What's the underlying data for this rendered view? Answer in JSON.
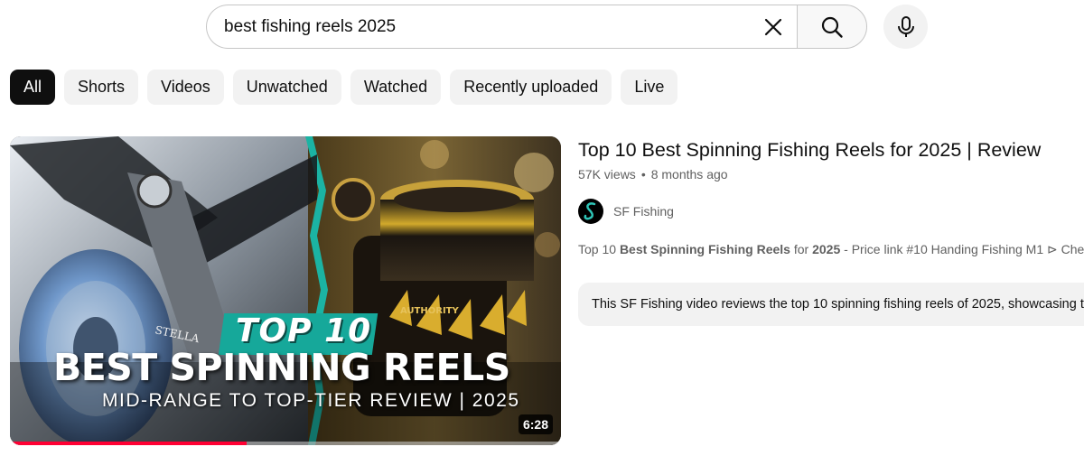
{
  "search": {
    "query": "best fishing reels 2025",
    "clear_icon": "close-icon",
    "search_icon": "search-icon",
    "mic_icon": "microphone-icon"
  },
  "chips": [
    "All",
    "Shorts",
    "Videos",
    "Unwatched",
    "Watched",
    "Recently uploaded",
    "Live"
  ],
  "active_chip": "All",
  "video": {
    "thumbnail": {
      "overlay_badge": "TOP 10",
      "overlay_title": "BEST SPINNING REELS",
      "overlay_subtitle": "MID-RANGE TO TOP-TIER REVIEW | 2025",
      "reel_brand_left": "STELLA",
      "reel_brand_right": "AUTHORITY",
      "duration": "6:28",
      "watch_progress": 0.43
    },
    "title": "Top 10 Best Spinning Fishing Reels for 2025 | Review",
    "views": "57K views",
    "separator": "•",
    "age": "8 months ago",
    "channel": "SF Fishing",
    "description_parts": [
      {
        "text": "Top 10 ",
        "bold": false
      },
      {
        "text": "Best Spinning Fishing Reels",
        "bold": true
      },
      {
        "text": " for ",
        "bold": false
      },
      {
        "text": "2025",
        "bold": true
      },
      {
        "text": " - Price link #10 Handing Fishing M1 ⊳ Che",
        "bold": false
      }
    ],
    "summary": "This SF Fishing video reviews the top 10 spinning fishing reels of 2025, showcasing t"
  },
  "colors": {
    "accent_red": "#ff0033",
    "chip_bg": "#f2f2f2",
    "chip_active_bg": "#0f0f0f",
    "teal_banner": "#16a89a"
  }
}
